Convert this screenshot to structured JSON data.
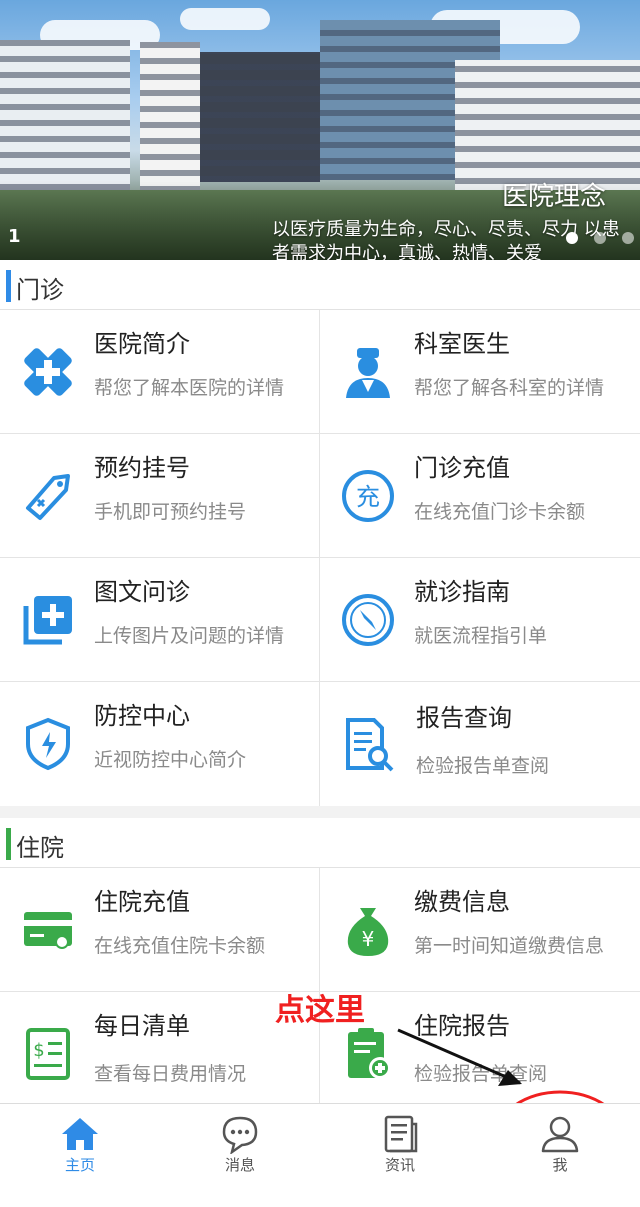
{
  "banner": {
    "title": "医院理念",
    "subtitle": "以医疗质量为生命，尽心、尽责、尽力 以患者需求为中心，真诚、热情、关爱",
    "slide_index": "1"
  },
  "outpatient": {
    "header": "门诊",
    "items": [
      {
        "title": "医院简介",
        "desc": "帮您了解本医院的详情",
        "icon": "hospital-cross-icon"
      },
      {
        "title": "科室医生",
        "desc": "帮您了解各科室的详情",
        "icon": "doctor-icon"
      },
      {
        "title": "预约挂号",
        "desc": "手机即可预约挂号",
        "icon": "tag-icon"
      },
      {
        "title": "门诊充值",
        "desc": "在线充值门诊卡余额",
        "icon": "recharge-icon"
      },
      {
        "title": "图文问诊",
        "desc": "上传图片及问题的详情",
        "icon": "add-layers-icon"
      },
      {
        "title": "就诊指南",
        "desc": "就医流程指引单",
        "icon": "compass-icon"
      },
      {
        "title": "防控中心",
        "desc": "近视防控中心简介",
        "icon": "shield-bolt-icon"
      },
      {
        "title": "报告查询",
        "desc": "检验报告单查阅",
        "icon": "report-search-icon"
      }
    ]
  },
  "inpatient": {
    "header": "住院",
    "items": [
      {
        "title": "住院充值",
        "desc": "在线充值住院卡余额",
        "icon": "card-icon"
      },
      {
        "title": "缴费信息",
        "desc": "第一时间知道缴费信息",
        "icon": "money-bag-icon"
      },
      {
        "title": "每日清单",
        "desc": "查看每日费用情况",
        "icon": "bill-list-icon"
      },
      {
        "title": "住院报告",
        "desc": "检验报告单查阅",
        "icon": "clipboard-icon"
      }
    ]
  },
  "annotation": "点这里",
  "tabs": [
    {
      "label": "主页",
      "icon": "home-icon"
    },
    {
      "label": "消息",
      "icon": "message-icon"
    },
    {
      "label": "资讯",
      "icon": "news-icon"
    },
    {
      "label": "我",
      "icon": "user-icon"
    }
  ],
  "colors": {
    "accent_blue": "#2f8be6",
    "icon_blue": "#2a8ee0",
    "icon_green": "#3aaa4a",
    "annotation_red": "#f02020"
  }
}
